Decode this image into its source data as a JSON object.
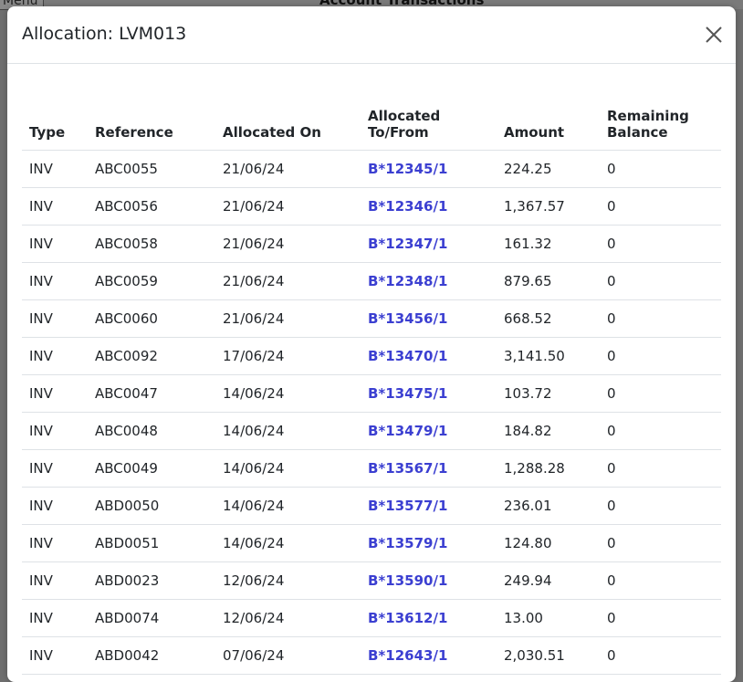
{
  "background": {
    "menu_label": "Menu",
    "page_title": "Account Transactions"
  },
  "modal": {
    "title": "Allocation: LVM013",
    "close_icon": "close-icon"
  },
  "table": {
    "headers": {
      "type": "Type",
      "reference": "Reference",
      "allocated_on": "Allocated On",
      "allocated_to_from": "Allocated To/From",
      "amount": "Amount",
      "remaining_balance": "Remaining Balance"
    },
    "rows": [
      {
        "type": "INV",
        "reference": "ABC0055",
        "allocated_on": "21/06/24",
        "allocated_to_from": "B*12345/1",
        "amount": "224.25",
        "remaining_balance": "0"
      },
      {
        "type": "INV",
        "reference": "ABC0056",
        "allocated_on": "21/06/24",
        "allocated_to_from": "B*12346/1",
        "amount": "1,367.57",
        "remaining_balance": "0"
      },
      {
        "type": "INV",
        "reference": "ABC0058",
        "allocated_on": "21/06/24",
        "allocated_to_from": "B*12347/1",
        "amount": "161.32",
        "remaining_balance": "0"
      },
      {
        "type": "INV",
        "reference": "ABC0059",
        "allocated_on": "21/06/24",
        "allocated_to_from": "B*12348/1",
        "amount": "879.65",
        "remaining_balance": "0"
      },
      {
        "type": "INV",
        "reference": "ABC0060",
        "allocated_on": "21/06/24",
        "allocated_to_from": "B*13456/1",
        "amount": "668.52",
        "remaining_balance": "0"
      },
      {
        "type": "INV",
        "reference": "ABC0092",
        "allocated_on": "17/06/24",
        "allocated_to_from": "B*13470/1",
        "amount": "3,141.50",
        "remaining_balance": "0"
      },
      {
        "type": "INV",
        "reference": "ABC0047",
        "allocated_on": "14/06/24",
        "allocated_to_from": "B*13475/1",
        "amount": "103.72",
        "remaining_balance": "0"
      },
      {
        "type": "INV",
        "reference": "ABC0048",
        "allocated_on": "14/06/24",
        "allocated_to_from": "B*13479/1",
        "amount": "184.82",
        "remaining_balance": "0"
      },
      {
        "type": "INV",
        "reference": "ABC0049",
        "allocated_on": "14/06/24",
        "allocated_to_from": "B*13567/1",
        "amount": "1,288.28",
        "remaining_balance": "0"
      },
      {
        "type": "INV",
        "reference": "ABD0050",
        "allocated_on": "14/06/24",
        "allocated_to_from": "B*13577/1",
        "amount": "236.01",
        "remaining_balance": "0"
      },
      {
        "type": "INV",
        "reference": "ABD0051",
        "allocated_on": "14/06/24",
        "allocated_to_from": "B*13579/1",
        "amount": "124.80",
        "remaining_balance": "0"
      },
      {
        "type": "INV",
        "reference": "ABD0023",
        "allocated_on": "12/06/24",
        "allocated_to_from": "B*13590/1",
        "amount": "249.94",
        "remaining_balance": "0"
      },
      {
        "type": "INV",
        "reference": "ABD0074",
        "allocated_on": "12/06/24",
        "allocated_to_from": "B*13612/1",
        "amount": "13.00",
        "remaining_balance": "0"
      },
      {
        "type": "INV",
        "reference": "ABD0042",
        "allocated_on": "07/06/24",
        "allocated_to_from": "B*12643/1",
        "amount": "2,030.51",
        "remaining_balance": "0"
      }
    ]
  },
  "colors": {
    "link": "#3b3fd1",
    "backdrop": "#6e6e6e",
    "border": "#dee2e6"
  }
}
